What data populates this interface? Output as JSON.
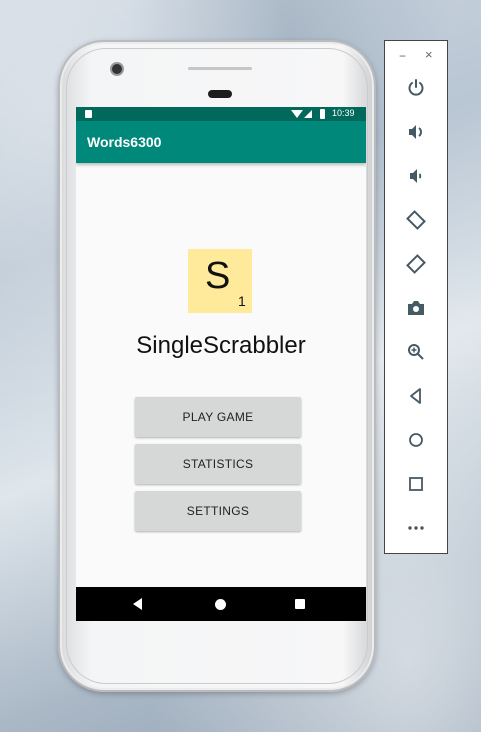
{
  "status_bar": {
    "time": "10:39"
  },
  "app_bar": {
    "title": "Words6300"
  },
  "tile": {
    "letter": "S",
    "score": "1"
  },
  "app_name": "SingleScrabbler",
  "buttons": {
    "play": "PLAY GAME",
    "statistics": "STATISTICS",
    "settings": "SETTINGS"
  },
  "emulator_toolbar": {
    "minimize": "−",
    "close": "×",
    "items": [
      "power-icon",
      "volume-up-icon",
      "volume-down-icon",
      "rotate-left-icon",
      "rotate-right-icon",
      "camera-icon",
      "zoom-icon",
      "back-icon",
      "home-icon",
      "overview-icon",
      "more-icon"
    ]
  },
  "colors": {
    "status_bar": "#00695c",
    "app_bar": "#00897b",
    "tile": "#ffe99a",
    "button": "#d6d7d7",
    "toolbar_icon": "#455a64"
  }
}
